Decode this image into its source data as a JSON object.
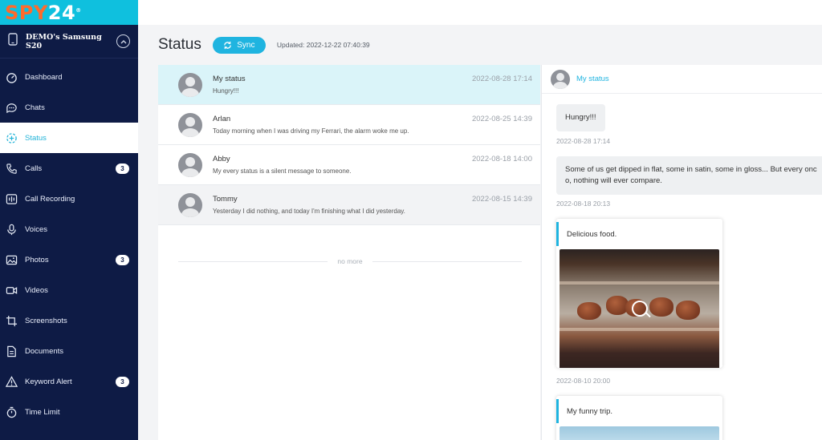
{
  "brand": {
    "spy": "SPY",
    "num": "24",
    "reg": "®"
  },
  "device": {
    "name": "DEMO's Samsung S20"
  },
  "sidebar": {
    "items": [
      {
        "label": "Dashboard",
        "icon": "dashboard-icon"
      },
      {
        "label": "Chats",
        "icon": "chat-icon"
      },
      {
        "label": "Status",
        "icon": "status-icon",
        "active": true
      },
      {
        "label": "Calls",
        "icon": "phone-icon",
        "badge": "3"
      },
      {
        "label": "Call Recording",
        "icon": "call-recording-icon"
      },
      {
        "label": "Voices",
        "icon": "microphone-icon"
      },
      {
        "label": "Photos",
        "icon": "photo-icon",
        "badge": "3"
      },
      {
        "label": "Videos",
        "icon": "video-icon"
      },
      {
        "label": "Screenshots",
        "icon": "crop-icon"
      },
      {
        "label": "Documents",
        "icon": "document-icon"
      },
      {
        "label": "Keyword Alert",
        "icon": "alert-icon",
        "badge": "3"
      },
      {
        "label": "Time Limit",
        "icon": "timer-icon"
      }
    ]
  },
  "header": {
    "title": "Status",
    "sync_label": "Sync",
    "updated": "Updated: 2022-12-22 07:40:39"
  },
  "list": {
    "rows": [
      {
        "name": "My status",
        "message": "Hungry!!!",
        "time": "2022-08-28 17:14"
      },
      {
        "name": "Arlan",
        "message": "Today morning when I was driving my Ferrari, the alarm woke me up.",
        "time": "2022-08-25 14:39"
      },
      {
        "name": "Abby",
        "message": "My every status is a silent message to someone.",
        "time": "2022-08-18 14:00"
      },
      {
        "name": "Tommy",
        "message": "Yesterday I did nothing, and today I'm finishing what I did yesterday.",
        "time": "2022-08-15 14:39"
      }
    ],
    "footer": "no more"
  },
  "detail": {
    "name": "My status",
    "posts": [
      {
        "text": "Hungry!!!",
        "time": "2022-08-28 17:14"
      },
      {
        "text": "Some of us get dipped in flat, some in satin, some in gloss... But every one of us, nothing will ever compare.",
        "line1": "Some of us get dipped in flat, some in satin, some in gloss... But every onc",
        "line2": "o, nothing will ever compare.",
        "time": "2022-08-18 20:13"
      },
      {
        "caption": "Delicious food.",
        "time": "2022-08-10 20:00"
      },
      {
        "caption": "My funny trip."
      }
    ]
  },
  "colors": {
    "accent": "#1fb4e0",
    "sidebar": "#0e1b45",
    "brand_orange": "#ff6a2b",
    "selected_row": "#daf4f9"
  }
}
